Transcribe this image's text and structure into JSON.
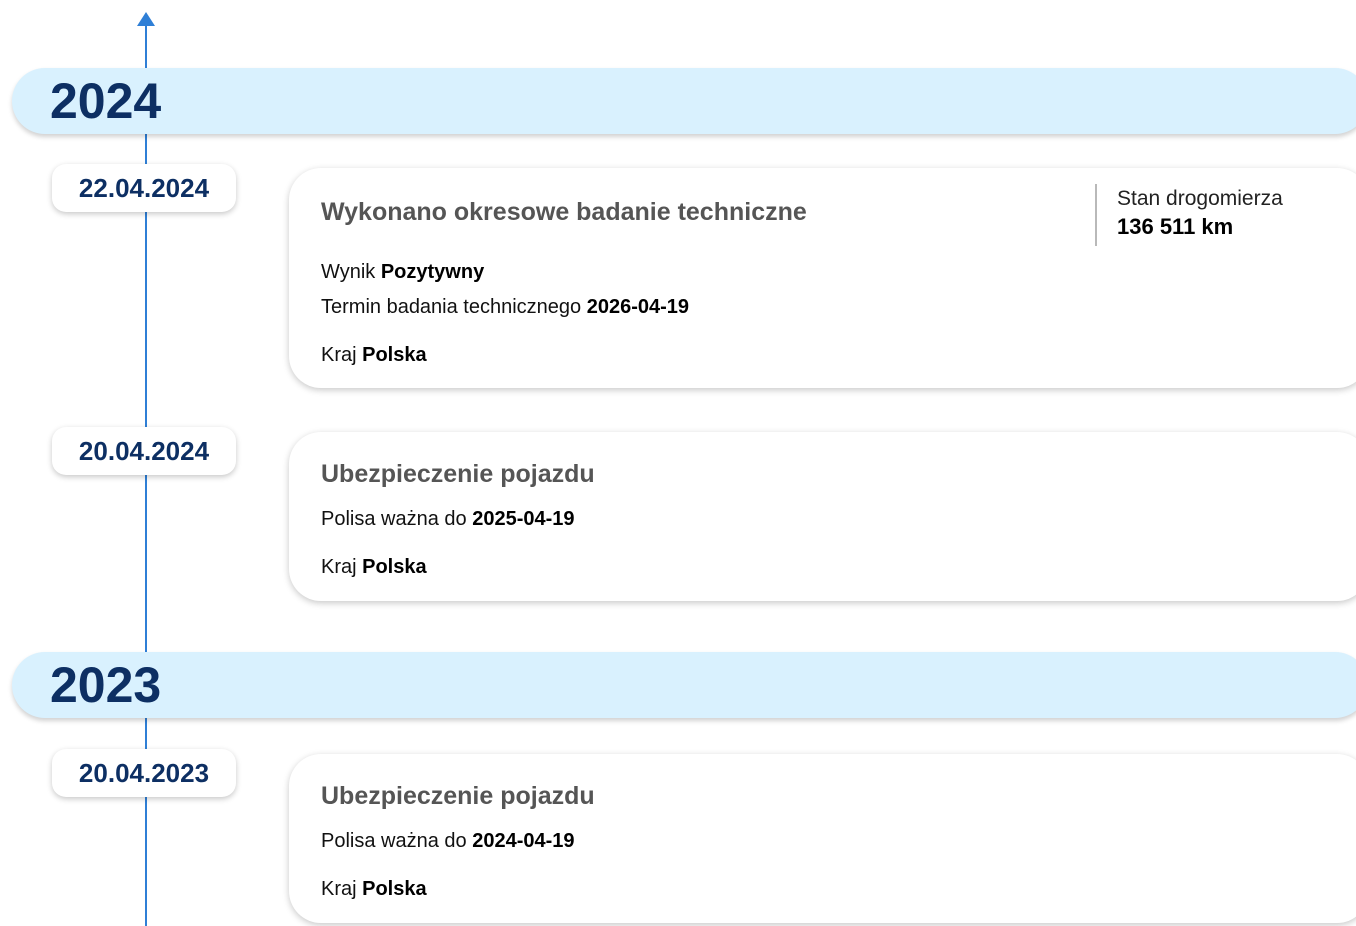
{
  "years": [
    {
      "label": "2024"
    },
    {
      "label": "2023"
    }
  ],
  "events": [
    {
      "date": "22.04.2024",
      "title": "Wykonano okresowe badanie techniczne",
      "rows": [
        {
          "label": "Wynik",
          "value": "Pozytywny"
        },
        {
          "label": "Termin badania technicznego",
          "value": "2026-04-19"
        },
        {
          "label": "Kraj",
          "value": "Polska"
        }
      ],
      "odometer": {
        "label": "Stan drogomierza",
        "value": "136 511 km"
      }
    },
    {
      "date": "20.04.2024",
      "title": "Ubezpieczenie pojazdu",
      "rows": [
        {
          "label": "Polisa ważna do",
          "value": "2025-04-19"
        },
        {
          "label": "Kraj",
          "value": "Polska"
        }
      ]
    },
    {
      "date": "20.04.2023",
      "title": "Ubezpieczenie pojazdu",
      "rows": [
        {
          "label": "Polisa ważna do",
          "value": "2024-04-19"
        },
        {
          "label": "Kraj",
          "value": "Polska"
        }
      ]
    }
  ],
  "colors": {
    "accent": "#2f7fd6",
    "year_band": "#d9f1fe",
    "year_text": "#0d2f63"
  }
}
